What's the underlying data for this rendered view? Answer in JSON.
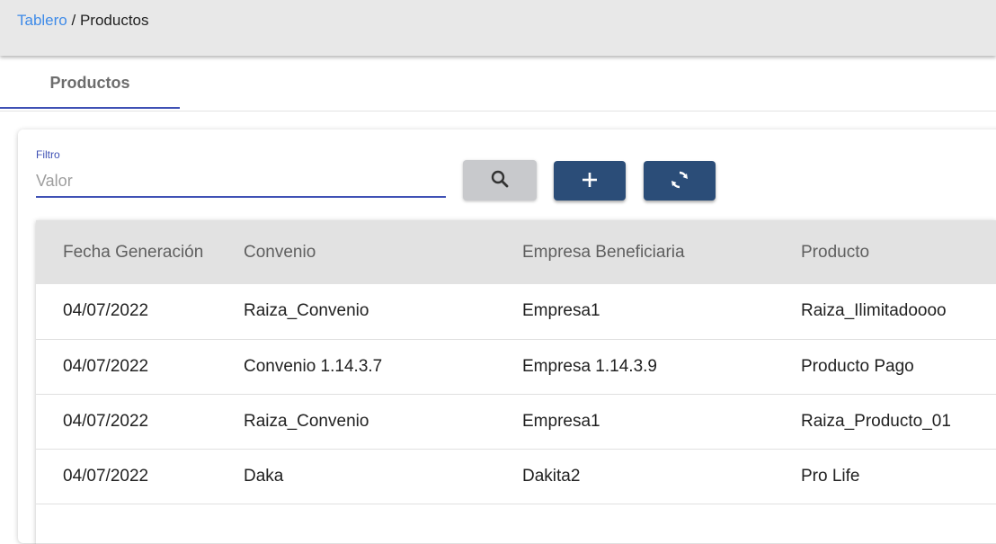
{
  "breadcrumb": {
    "link": "Tablero",
    "separator": "/",
    "current": "Productos"
  },
  "tabs": [
    {
      "label": "Productos",
      "active": true
    }
  ],
  "filter": {
    "label": "Filtro",
    "placeholder": "Valor",
    "value": ""
  },
  "buttons": {
    "search_icon": "search-icon",
    "add_icon": "plus-icon",
    "refresh_icon": "refresh-icon"
  },
  "table": {
    "columns": [
      "Fecha Generación",
      "Convenio",
      "Empresa Beneficiaria",
      "Producto"
    ],
    "rows": [
      [
        "04/07/2022",
        "Raiza_Convenio",
        "Empresa1",
        "Raiza_Ilimitadoooo"
      ],
      [
        "04/07/2022",
        "Convenio 1.14.3.7",
        "Empresa 1.14.3.9",
        "Producto Pago"
      ],
      [
        "04/07/2022",
        "Raiza_Convenio",
        "Empresa1",
        "Raiza_Producto_01"
      ],
      [
        "04/07/2022",
        "Daka",
        "Dakita2",
        "Pro Life"
      ]
    ]
  },
  "colors": {
    "accent": "#3f51b5",
    "link": "#3f8be8",
    "primary_button": "#2b4d78",
    "secondary_button": "#c8c9cc"
  }
}
